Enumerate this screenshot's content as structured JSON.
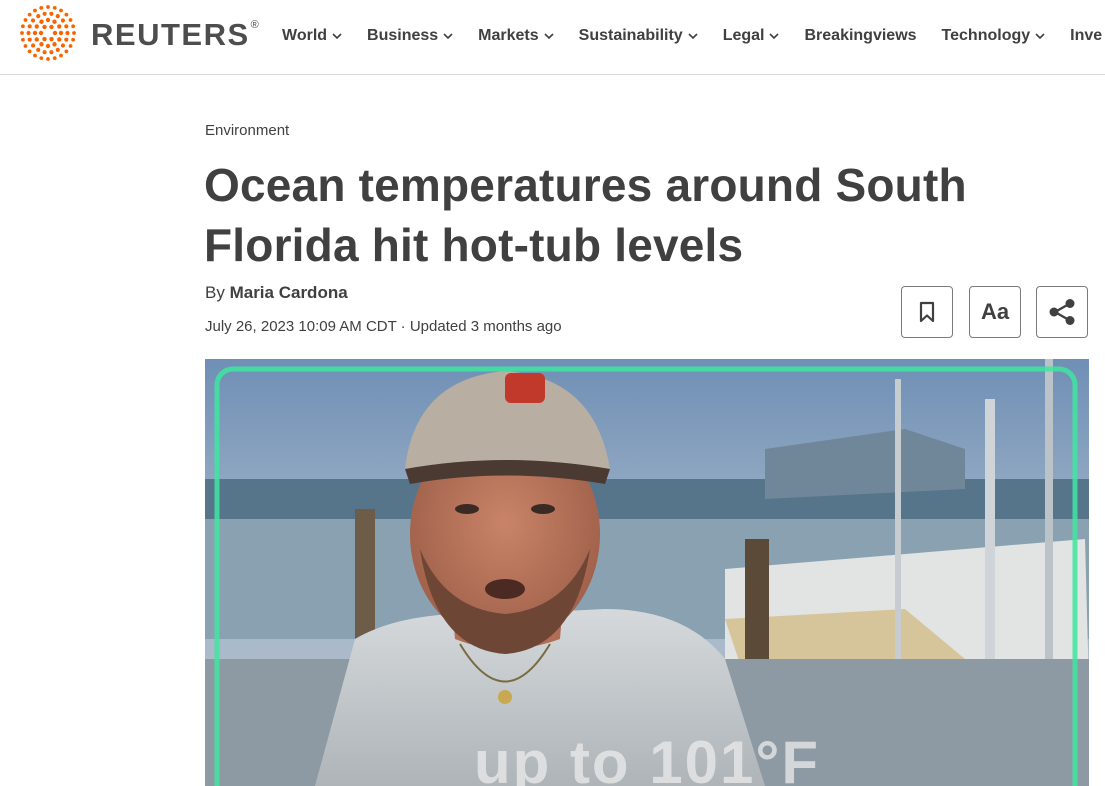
{
  "brand": {
    "name": "REUTERS",
    "registered": "®",
    "color": "#fa6400"
  },
  "nav": {
    "items": [
      {
        "label": "World",
        "has_dropdown": true
      },
      {
        "label": "Business",
        "has_dropdown": true
      },
      {
        "label": "Markets",
        "has_dropdown": true
      },
      {
        "label": "Sustainability",
        "has_dropdown": true
      },
      {
        "label": "Legal",
        "has_dropdown": true
      },
      {
        "label": "Breakingviews",
        "has_dropdown": false
      },
      {
        "label": "Technology",
        "has_dropdown": true
      },
      {
        "label": "Inve",
        "has_dropdown": false
      }
    ]
  },
  "article": {
    "section": "Environment",
    "headline": "Ocean temperatures around South Florida hit hot-tub levels",
    "byline_prefix": "By",
    "author": "Maria Cardona",
    "dateline": "July 26, 2023 10:09 AM CDT · Updated 3 months ago"
  },
  "toolbar": {
    "bookmark_icon": "bookmark-icon",
    "text_size_label": "Aa",
    "share_icon": "share-icon"
  },
  "video": {
    "caption": "up to 101°F",
    "frame_color": "#3ee6a0"
  }
}
